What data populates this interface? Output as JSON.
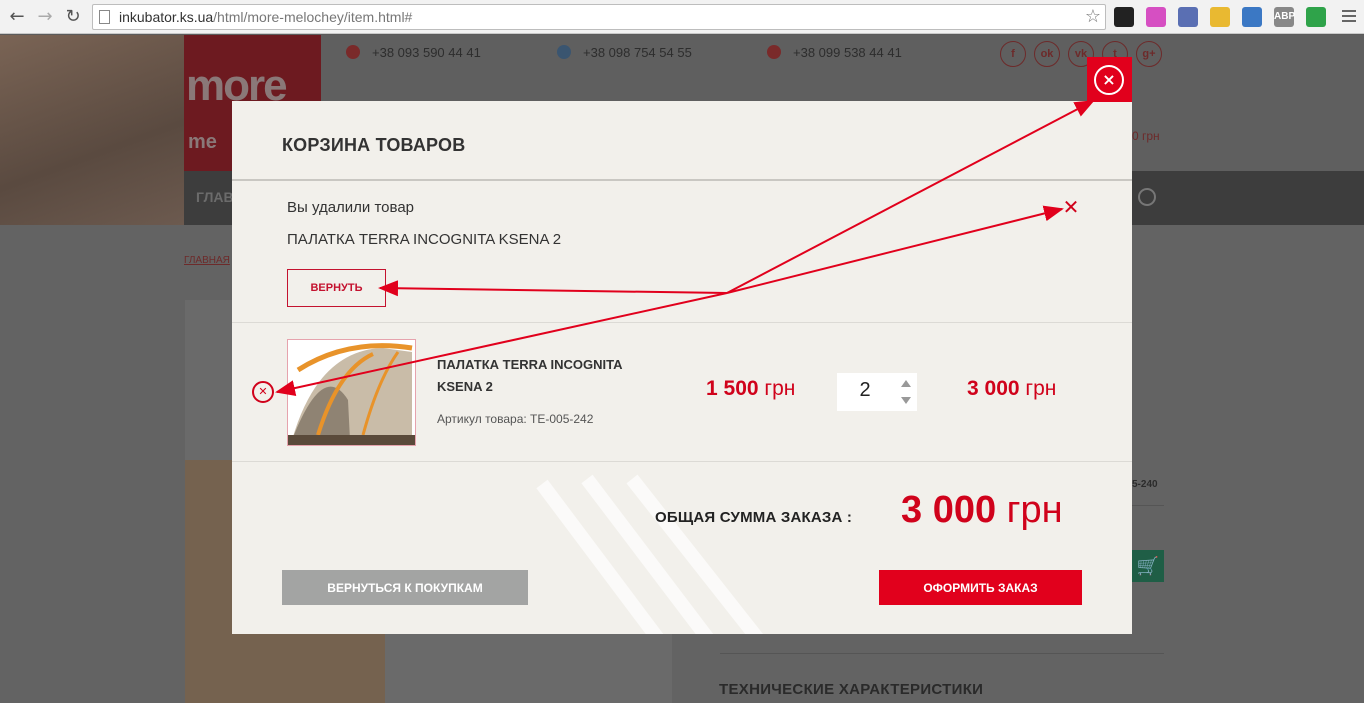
{
  "browser": {
    "url_host": "inkubator.ks.ua",
    "url_path": "/html/more-melochey/item.html#",
    "extensions": [
      {
        "icon": "checklist-extension-icon",
        "color": "#222222",
        "label": ""
      },
      {
        "icon": "gradient-extension-icon",
        "color": "#d64fc2",
        "label": ""
      },
      {
        "icon": "shield-extension-icon",
        "color": "#5a6fb3",
        "label": ""
      },
      {
        "icon": "pencil-extension-icon",
        "color": "#e9b931",
        "label": ""
      },
      {
        "icon": "screen-extension-icon",
        "color": "#3b78c4",
        "label": ""
      },
      {
        "icon": "adblock-extension-icon",
        "color": "#888888",
        "label": "ABP"
      },
      {
        "icon": "hangouts-extension-icon",
        "color": "#2fa34a",
        "label": ""
      }
    ]
  },
  "background": {
    "phones": [
      "+38 093 590 44 41",
      "+38 098 754 54 55",
      "+38 099 538 44 41"
    ],
    "social": [
      "f",
      "ok",
      "vk",
      "t",
      "g+"
    ],
    "logo_line1": "more",
    "logo_line2": "me",
    "nav_text": "ГЛАВ",
    "breadcrumb": "ГЛАВНАЯ",
    "price_fragment": "0 грн",
    "code_fragment": "5-240",
    "tech_title": "ТЕХНИЧЕСКИЕ ХАРАКТЕРИСТИКИ"
  },
  "modal": {
    "title": "КОРЗИНА ТОВАРОВ",
    "removed_message": "Вы удалили товар",
    "removed_product": "ПАЛАТКА TERRA INCOGNITA KSENA 2",
    "restore_label": "ВЕРНУТЬ",
    "item": {
      "name": "ПАЛАТКА TERRA INCOGNITA KSENA 2",
      "sku": "Артикул товара: TE-005-242",
      "price_value": "1 500",
      "price_currency": "грн",
      "quantity": "2",
      "sum_value": "3 000",
      "sum_currency": "грн"
    },
    "total_label": "ОБЩАЯ СУММА ЗАКАЗА :",
    "total_value": "3 000",
    "total_currency": "грн",
    "back_label": "ВЕРНУТЬСЯ К ПОКУПКАМ",
    "order_label": "ОФОРМИТЬ ЗАКАЗ"
  },
  "colors": {
    "accent": "#e1001c",
    "price": "#d0021b",
    "modal_bg": "#f2f0eb",
    "back_button": "#a3a4a3"
  }
}
